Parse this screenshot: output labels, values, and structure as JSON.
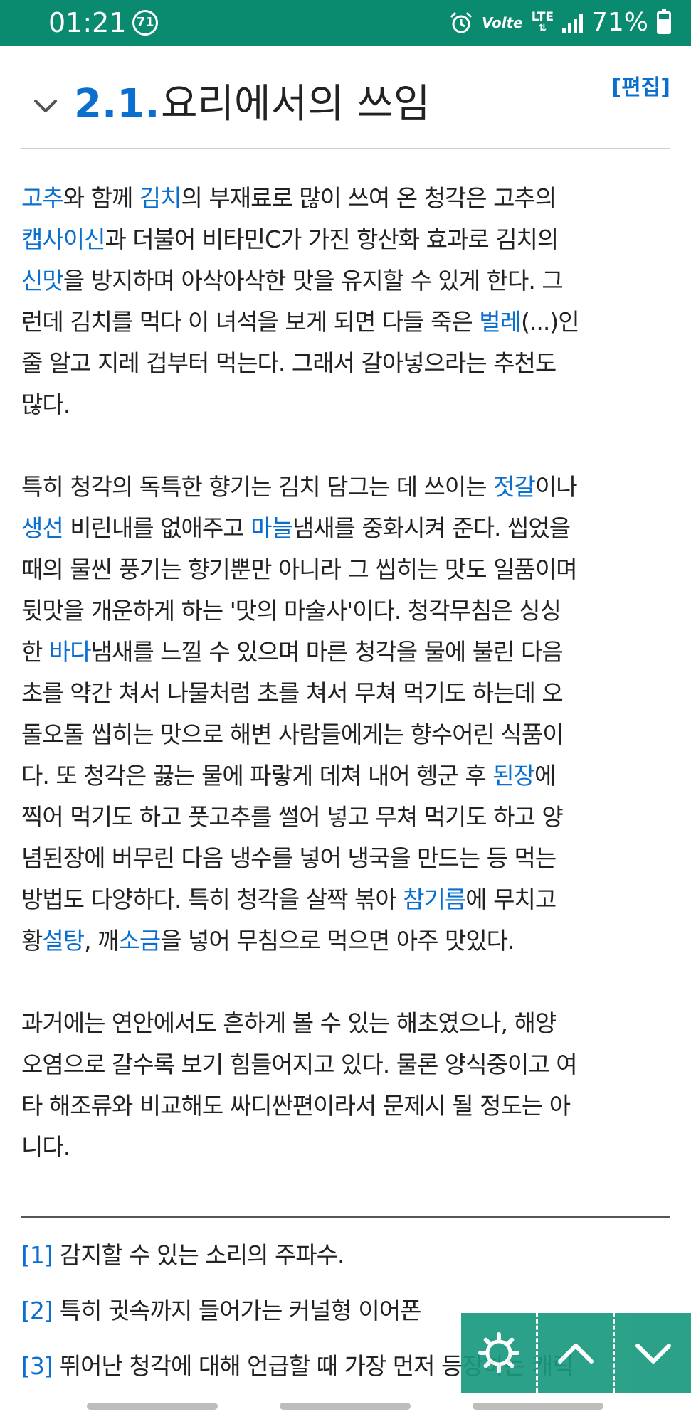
{
  "status_bar": {
    "time": "01:21",
    "notification_badge": "71",
    "volte": "Volte",
    "lte": "LTE",
    "battery": "71%",
    "battery_level": 0.71,
    "color": "#0a8a6e"
  },
  "heading": {
    "number": "2.1.",
    "title": "요리에서의 쓰임",
    "edit_label": "[편집]"
  },
  "paragraphs": [
    {
      "lines": [
        [
          {
            "t": "고추",
            "link": true
          },
          {
            "t": "와 함께 "
          },
          {
            "t": "김치",
            "link": true
          },
          {
            "t": "의 부재료로 많이 쓰여 온 청각은 고추의"
          }
        ],
        [
          {
            "t": "캡사이신",
            "link": true
          },
          {
            "t": "과 더불어 비타민C가 가진 항산화 효과로 김치의"
          }
        ],
        [
          {
            "t": "신맛",
            "link": true
          },
          {
            "t": "을 방지하며 아삭아삭한 맛을 유지할 수 있게 한다. 그"
          }
        ],
        [
          {
            "t": "런데 김치를 먹다 이 녀석을 보게 되면 다들 죽은 "
          },
          {
            "t": "벌레",
            "link": true
          },
          {
            "t": "(...)인"
          }
        ],
        [
          {
            "t": "줄 알고 지레 겁부터 먹는다. 그래서 갈아넣으라는 추천도"
          }
        ],
        [
          {
            "t": "많다."
          }
        ]
      ]
    },
    {
      "lines": [
        [
          {
            "t": "특히 청각의 독특한 향기는 김치 담그는 데 쓰이는 "
          },
          {
            "t": "젓갈",
            "link": true
          },
          {
            "t": "이나"
          }
        ],
        [
          {
            "t": "생선",
            "link": true
          },
          {
            "t": " 비린내를 없애주고 "
          },
          {
            "t": "마늘",
            "link": true
          },
          {
            "t": "냄새를 중화시켜 준다. 씹었을"
          }
        ],
        [
          {
            "t": "때의 물씬 풍기는 향기뿐만 아니라 그 씹히는 맛도 일품이며"
          }
        ],
        [
          {
            "t": "뒷맛을 개운하게 하는 '맛의 마술사'이다. 청각무침은 싱싱"
          }
        ],
        [
          {
            "t": "한 "
          },
          {
            "t": "바다",
            "link": true
          },
          {
            "t": "냄새를 느낄 수 있으며 마른 청각을 물에 불린 다음"
          }
        ],
        [
          {
            "t": "초를 약간 쳐서 나물처럼 초를 쳐서 무쳐 먹기도 하는데 오"
          }
        ],
        [
          {
            "t": "돌오돌 씹히는 맛으로 해변 사람들에게는 향수어린 식품이"
          }
        ],
        [
          {
            "t": "다. 또 청각은 끓는 물에 파랗게 데쳐 내어 헹군 후 "
          },
          {
            "t": "된장",
            "link": true
          },
          {
            "t": "에"
          }
        ],
        [
          {
            "t": "찍어 먹기도 하고 풋고추를 썰어 넣고 무쳐 먹기도 하고 양"
          }
        ],
        [
          {
            "t": "념된장에 버무린 다음 냉수를 넣어 냉국을 만드는 등 먹는"
          }
        ],
        [
          {
            "t": "방법도 다양하다. 특히 청각을 살짝 볶아 "
          },
          {
            "t": "참기름",
            "link": true
          },
          {
            "t": "에 무치고"
          }
        ],
        [
          {
            "t": "황"
          },
          {
            "t": "설탕",
            "link": true
          },
          {
            "t": ", 깨"
          },
          {
            "t": "소금",
            "link": true
          },
          {
            "t": "을 넣어 무침으로 먹으면 아주 맛있다."
          }
        ]
      ]
    },
    {
      "lines": [
        [
          {
            "t": "과거에는 연안에서도 흔하게 볼 수 있는 해초였으나, 해양"
          }
        ],
        [
          {
            "t": "오염으로 갈수록 보기 힘들어지고 있다. 물론 양식중이고 여"
          }
        ],
        [
          {
            "t": "타 해조류와 비교해도 싸디싼편이라서 문제시 될 정도는 아"
          }
        ],
        [
          {
            "t": "니다."
          }
        ]
      ]
    }
  ],
  "footnotes": [
    {
      "ref": "[1]",
      "text": "감지할 수 있는 소리의 주파수."
    },
    {
      "ref": "[2]",
      "text": "특히 귓속까지 들어가는 커널형 이어폰"
    },
    {
      "ref": "[3]",
      "text": "뛰어난 청각에 대해 언급할 때 가장 먼저 등장하는 캐릭"
    }
  ],
  "fab_buttons": [
    {
      "name": "settings",
      "icon": "gear-icon"
    },
    {
      "name": "scroll-up",
      "icon": "chevron-up-icon"
    },
    {
      "name": "scroll-down",
      "icon": "chevron-down-icon"
    }
  ],
  "colors": {
    "link": "#0b6fd0",
    "fab": "#1a9a7f"
  }
}
